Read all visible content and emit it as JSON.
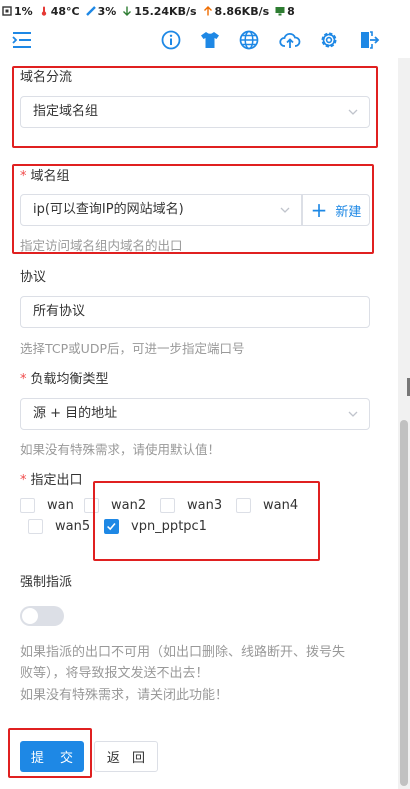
{
  "status_bar": {
    "cpu": "1%",
    "temp": "48°C",
    "mem": "3%",
    "down": "15.24KB/s",
    "up": "8.86KB/s",
    "net_badge": "8"
  },
  "colors": {
    "primary": "#1e88e5",
    "annotation": "#e02020",
    "required": "#f04a4a"
  },
  "toolbar": {
    "icons": [
      "menu-icon",
      "info-icon",
      "tshirt-icon",
      "globe-icon",
      "cloud-upload-icon",
      "gear-icon",
      "logout-icon"
    ]
  },
  "form": {
    "domain_mode": {
      "label": "域名分流",
      "value": "指定域名组"
    },
    "domain_group": {
      "label": "域名组",
      "value": "ip(可以查询IP的网站域名)",
      "new_label": "新建",
      "help": "指定访问域名组内域名的出口"
    },
    "protocol": {
      "label": "协议",
      "value": "所有协议",
      "help": "选择TCP或UDP后，可进一步指定端口号"
    },
    "lb_type": {
      "label": "负载均衡类型",
      "value": "源 + 目的地址",
      "help": "如果没有特殊需求，请使用默认值！"
    },
    "outlet": {
      "label": "指定出口",
      "options": [
        {
          "name": "wan",
          "checked": false
        },
        {
          "name": "wan2",
          "checked": false
        },
        {
          "name": "wan3",
          "checked": false
        },
        {
          "name": "wan4",
          "checked": false
        },
        {
          "name": "wan5",
          "checked": false
        },
        {
          "name": "vpn_pptpc1",
          "checked": true
        }
      ]
    },
    "force": {
      "label": "强制指派",
      "on": false,
      "note1": "如果指派的出口不可用（如出口删除、线路断开、拨号失",
      "note2": "败等），将导致报文发送不出去！",
      "note3": "如果没有特殊需求，请关闭此功能！"
    }
  },
  "actions": {
    "submit": "提 交",
    "back": "返 回"
  }
}
